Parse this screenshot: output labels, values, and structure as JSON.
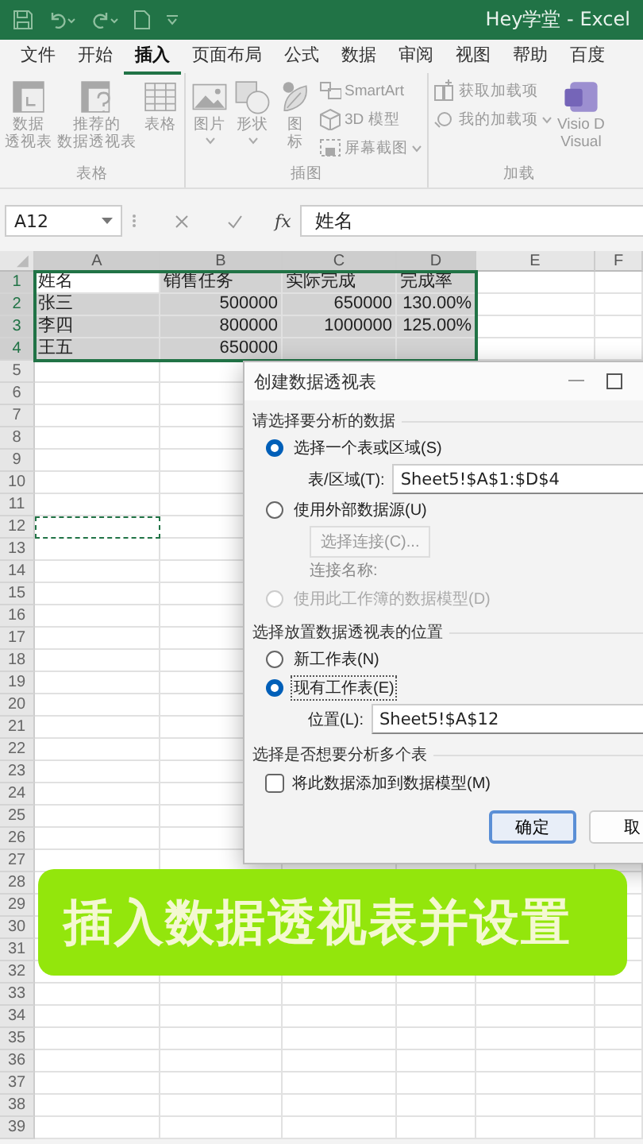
{
  "title_bar": {
    "title": "Hey学堂 - Excel"
  },
  "ribbon_tabs": [
    {
      "label": "文件",
      "selected": false
    },
    {
      "label": "开始",
      "selected": false
    },
    {
      "label": "插入",
      "selected": true
    },
    {
      "label": "页面布局",
      "selected": false
    },
    {
      "label": "公式",
      "selected": false
    },
    {
      "label": "数据",
      "selected": false
    },
    {
      "label": "审阅",
      "selected": false
    },
    {
      "label": "视图",
      "selected": false
    },
    {
      "label": "帮助",
      "selected": false
    },
    {
      "label": "百度",
      "selected": false
    }
  ],
  "ribbon": {
    "disabled": true,
    "groups": [
      {
        "label": "表格",
        "items": [
          {
            "kind": "large",
            "lines": [
              "数据",
              "透视表"
            ],
            "dropdown": false
          },
          {
            "kind": "large",
            "lines": [
              "推荐的",
              "数据透视表"
            ],
            "dropdown": false
          },
          {
            "kind": "large",
            "lines": [
              "表格"
            ],
            "dropdown": false
          }
        ]
      },
      {
        "label": "插图",
        "items": [
          {
            "kind": "large",
            "lines": [
              "图片"
            ],
            "dropdown": true
          },
          {
            "kind": "large",
            "lines": [
              "形状"
            ],
            "dropdown": true
          },
          {
            "kind": "large",
            "lines": [
              "图",
              "标"
            ],
            "dropdown": false
          },
          {
            "kind": "stack",
            "items": [
              {
                "label": "SmartArt",
                "dropdown": false
              },
              {
                "label": "3D 模型",
                "dropdown": false
              },
              {
                "label": "屏幕截图",
                "dropdown": true
              }
            ]
          }
        ]
      },
      {
        "label": "加载",
        "items": [
          {
            "kind": "stack",
            "items": [
              {
                "label": "获取加载项",
                "dropdown": false
              },
              {
                "label": "我的加载项",
                "dropdown": true
              }
            ]
          },
          {
            "kind": "large",
            "lines": [
              "Visio D",
              "Visual"
            ],
            "dropdown": false
          }
        ]
      }
    ]
  },
  "formula_bar": {
    "name_box": "A12",
    "function_label": "fx",
    "value": "姓名"
  },
  "sheet": {
    "columns": [
      {
        "label": "A",
        "selected": true
      },
      {
        "label": "B",
        "selected": true
      },
      {
        "label": "C",
        "selected": true
      },
      {
        "label": "D",
        "selected": true
      },
      {
        "label": "E",
        "selected": false
      },
      {
        "label": "F",
        "selected": false
      }
    ],
    "rows": [
      {
        "number": "1",
        "selected": true,
        "cells": [
          {
            "kind": "text",
            "text": "姓名",
            "selected": true,
            "active": true
          },
          {
            "kind": "text",
            "text": "销售任务",
            "selected": true,
            "active": false
          },
          {
            "kind": "text",
            "text": "实际完成",
            "selected": true,
            "active": false
          },
          {
            "kind": "text",
            "text": "完成率",
            "selected": true,
            "active": false
          }
        ]
      },
      {
        "number": "2",
        "selected": true,
        "cells": [
          {
            "kind": "text",
            "text": "张三",
            "selected": true,
            "active": false
          },
          {
            "kind": "number",
            "text": "500000",
            "selected": true,
            "active": false
          },
          {
            "kind": "number",
            "text": "650000",
            "selected": true,
            "active": false
          },
          {
            "kind": "number",
            "text": "130.00%",
            "selected": true,
            "active": false
          }
        ]
      },
      {
        "number": "3",
        "selected": true,
        "cells": [
          {
            "kind": "text",
            "text": "李四",
            "selected": true,
            "active": false
          },
          {
            "kind": "number",
            "text": "800000",
            "selected": true,
            "active": false
          },
          {
            "kind": "number",
            "text": "1000000",
            "selected": true,
            "active": false
          },
          {
            "kind": "number",
            "text": "125.00%",
            "selected": true,
            "active": false
          }
        ]
      },
      {
        "number": "4",
        "selected": true,
        "cells": [
          {
            "kind": "text",
            "text": "王五",
            "selected": true,
            "active": false
          },
          {
            "kind": "number",
            "text": "650000",
            "selected": true,
            "active": false
          },
          {
            "kind": "empty",
            "selected": true,
            "active": false
          },
          {
            "kind": "empty",
            "selected": true,
            "active": false
          }
        ]
      },
      {
        "number": "5",
        "selected": false
      },
      {
        "number": "6",
        "selected": false
      },
      {
        "number": "7",
        "selected": false
      },
      {
        "number": "8",
        "selected": false
      },
      {
        "number": "9",
        "selected": false
      },
      {
        "number": "10",
        "selected": false
      },
      {
        "number": "11",
        "selected": false
      },
      {
        "number": "12",
        "selected": false,
        "cells": [
          {
            "kind": "empty",
            "selected": false,
            "marquee": true
          }
        ]
      },
      {
        "number": "13",
        "selected": false
      },
      {
        "number": "14",
        "selected": false
      },
      {
        "number": "15",
        "selected": false
      },
      {
        "number": "16",
        "selected": false
      },
      {
        "number": "17",
        "selected": false
      },
      {
        "number": "18",
        "selected": false
      },
      {
        "number": "19",
        "selected": false
      },
      {
        "number": "20",
        "selected": false
      },
      {
        "number": "21",
        "selected": false
      },
      {
        "number": "22",
        "selected": false
      },
      {
        "number": "23",
        "selected": false
      },
      {
        "number": "24",
        "selected": false
      },
      {
        "number": "25",
        "selected": false
      },
      {
        "number": "26",
        "selected": false
      },
      {
        "number": "27",
        "selected": false
      },
      {
        "number": "28",
        "selected": false
      },
      {
        "number": "29",
        "selected": false
      },
      {
        "number": "30",
        "selected": false
      },
      {
        "number": "31",
        "selected": false
      },
      {
        "number": "32",
        "selected": false
      },
      {
        "number": "33",
        "selected": false
      },
      {
        "number": "34",
        "selected": false
      },
      {
        "number": "35",
        "selected": false
      },
      {
        "number": "36",
        "selected": false
      },
      {
        "number": "37",
        "selected": false
      },
      {
        "number": "38",
        "selected": false
      },
      {
        "number": "39",
        "selected": false
      }
    ]
  },
  "dialog": {
    "title": "创建数据透视表",
    "sections": [
      {
        "label": "请选择要分析的数据",
        "items": [
          {
            "kind": "radio",
            "label": "选择一个表或区域(S)",
            "selected": true,
            "disabled": false,
            "focused": false
          },
          {
            "kind": "field",
            "label": "表/区域(T):",
            "value": "Sheet5!$A$1:$D$4"
          },
          {
            "kind": "radio",
            "label": "使用外部数据源(U)",
            "selected": false,
            "disabled": false,
            "focused": false
          },
          {
            "kind": "button",
            "label": "选择连接(C)...",
            "disabled": true
          },
          {
            "kind": "note",
            "label": "连接名称:"
          },
          {
            "kind": "radio",
            "label": "使用此工作簿的数据模型(D)",
            "selected": false,
            "disabled": true,
            "focused": false
          }
        ]
      },
      {
        "label": "选择放置数据透视表的位置",
        "items": [
          {
            "kind": "radio",
            "label": "新工作表(N)",
            "selected": false,
            "disabled": false,
            "focused": false
          },
          {
            "kind": "radio",
            "label": "现有工作表(E)",
            "selected": true,
            "disabled": false,
            "focused": true
          },
          {
            "kind": "field",
            "label": "位置(L):",
            "value": "Sheet5!$A$12"
          }
        ]
      },
      {
        "label": "选择是否想要分析多个表",
        "items": [
          {
            "kind": "checkbox",
            "label": "将此数据添加到数据模型(M)",
            "checked": false
          }
        ]
      }
    ],
    "buttons": [
      {
        "label": "确定",
        "default": true
      },
      {
        "label": "取",
        "default": false
      }
    ]
  },
  "banner": {
    "text": "插入数据透视表并设置"
  }
}
